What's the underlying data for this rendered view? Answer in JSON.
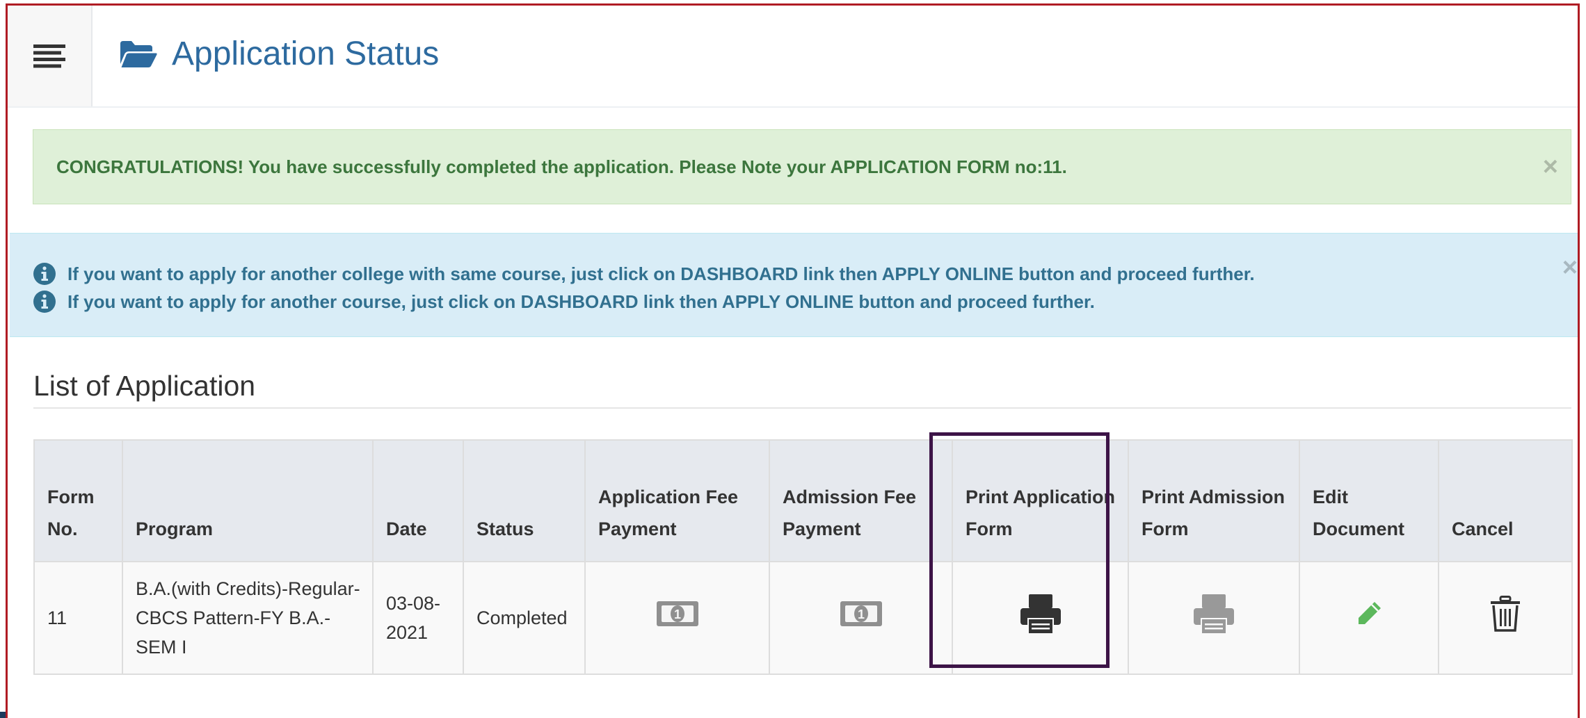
{
  "header": {
    "title": "Application Status",
    "folder_icon": "folder-open-icon",
    "menu_icon": "hamburger-menu-icon"
  },
  "alerts": {
    "success": {
      "text": "CONGRATULATIONS! You have successfully completed the application. Please Note your APPLICATION FORM no:11.",
      "close": "×",
      "color": "#3c763d",
      "background": "#dff0d8"
    },
    "info": {
      "lines": [
        "If you want to apply for another college with same course, just click on DASHBOARD link then APPLY ONLINE button and proceed further.",
        "If you want to apply for another course, just click on DASHBOARD link then APPLY ONLINE button and proceed further."
      ],
      "close": "×",
      "icon": "info-circle-icon",
      "color": "#31708f",
      "background": "#d9edf7"
    }
  },
  "list": {
    "title": "List of Application",
    "columns": [
      "Form No.",
      "Program",
      "Date",
      "Status",
      "Application Fee Payment",
      "Admission Fee Payment",
      "Print Application Form",
      "Print Admission Form",
      "Edit Document",
      "Cancel"
    ],
    "rows": [
      {
        "form_no": "11",
        "program": "B.A.(with Credits)-Regular-CBCS Pattern-FY B.A.-SEM I",
        "date": "03-08-2021",
        "status": "Completed",
        "application_fee_icon": "money-bill-icon",
        "admission_fee_icon": "money-bill-icon",
        "print_application_icon": "printer-icon",
        "print_admission_icon": "printer-icon",
        "edit_icon": "pencil-icon",
        "cancel_icon": "trash-icon"
      }
    ]
  },
  "colors": {
    "frame_border": "#b01c24",
    "title": "#2d6a9f",
    "highlight": "#3d1447",
    "table_header": "#e6e9ee"
  }
}
